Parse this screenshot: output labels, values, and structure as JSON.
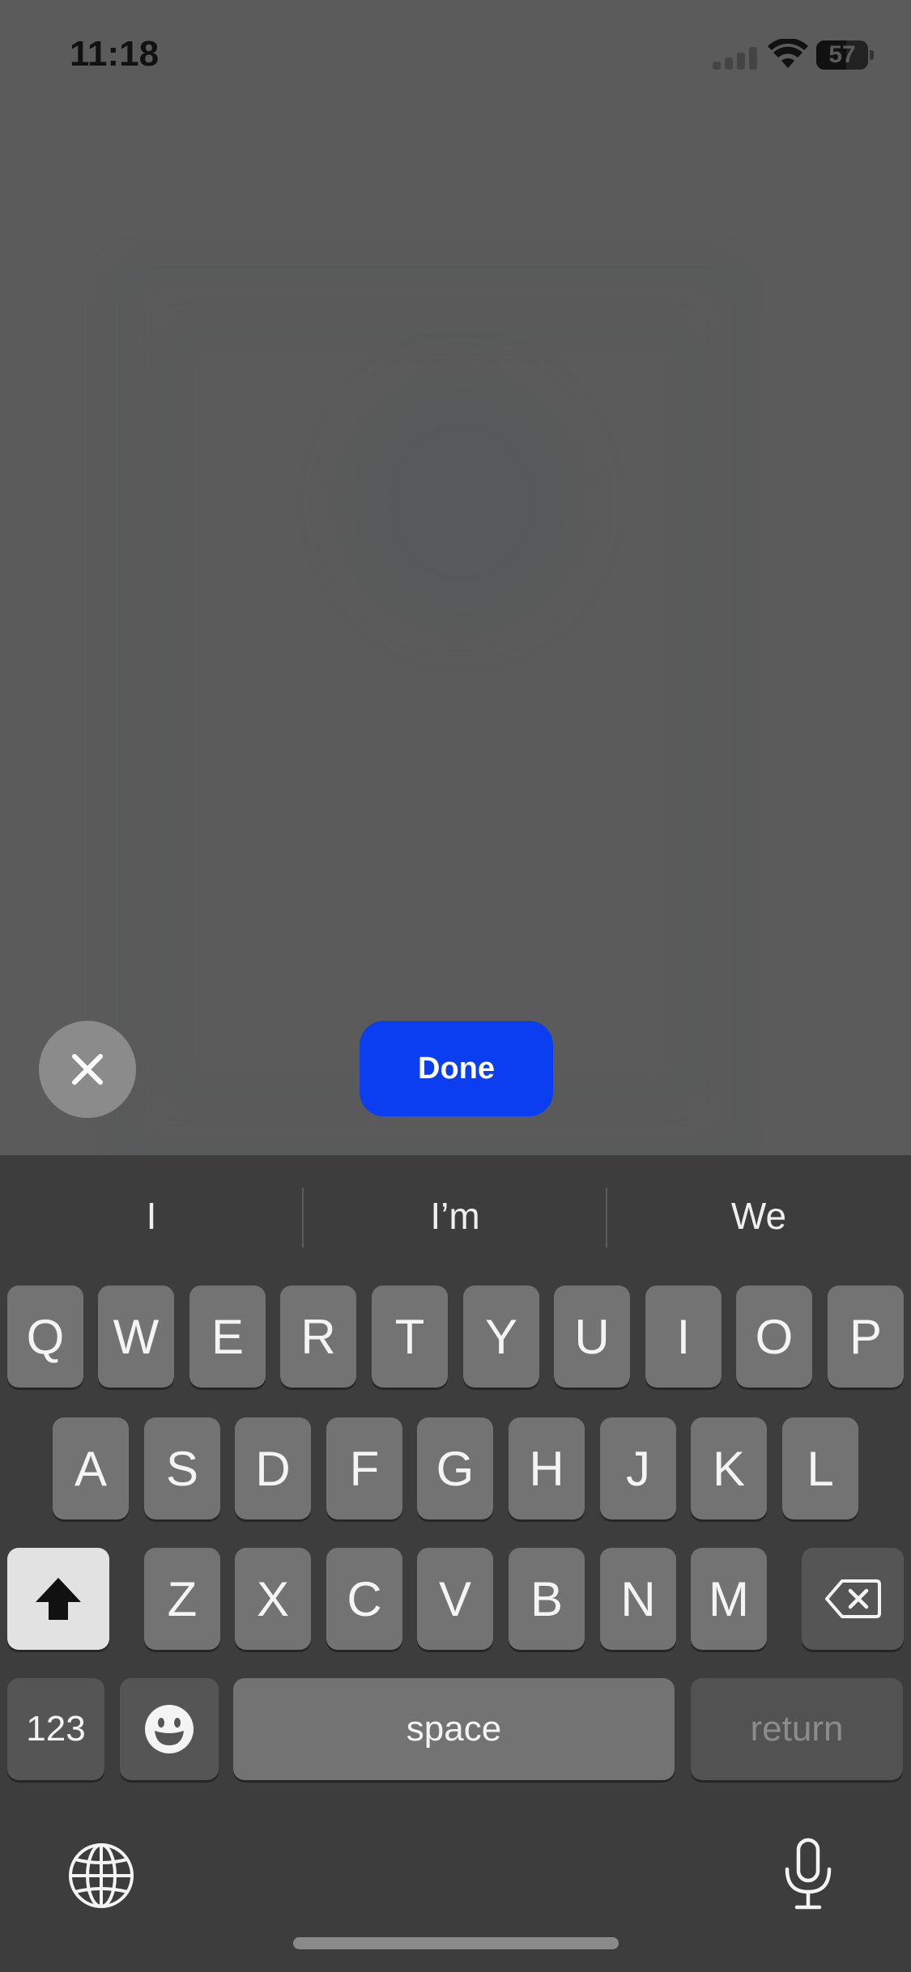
{
  "status_bar": {
    "time": "11:18",
    "battery": "57",
    "signal_icon": "cellular-signal-icon",
    "wifi_icon": "wifi-icon",
    "battery_icon": "battery-icon"
  },
  "overlay": {
    "close_icon": "close-icon",
    "done_label": "Done",
    "done_color": "#0A3EF0"
  },
  "keyboard": {
    "suggestions": [
      "I",
      "I’m",
      "We"
    ],
    "row1": [
      "Q",
      "W",
      "E",
      "R",
      "T",
      "Y",
      "U",
      "I",
      "O",
      "P"
    ],
    "row2": [
      "A",
      "S",
      "D",
      "F",
      "G",
      "H",
      "J",
      "K",
      "L"
    ],
    "row3": [
      "Z",
      "X",
      "C",
      "V",
      "B",
      "N",
      "M"
    ],
    "shift_icon": "shift-icon",
    "delete_icon": "delete-backspace-icon",
    "numbers_label": "123",
    "emoji_icon": "emoji-icon",
    "space_label": "space",
    "return_label": "return",
    "globe_icon": "globe-icon",
    "mic_icon": "microphone-icon"
  }
}
